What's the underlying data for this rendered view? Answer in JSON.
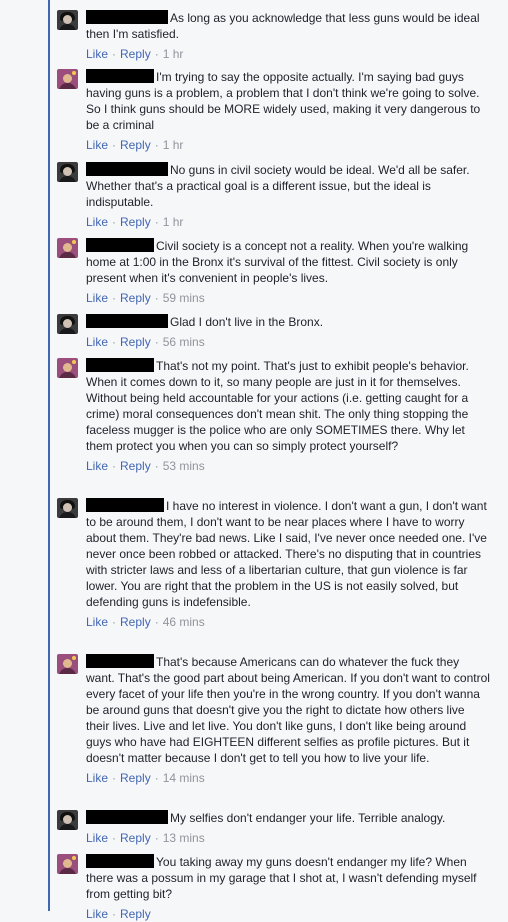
{
  "thread": {
    "separator": "·",
    "comments": [
      {
        "author_type": "a",
        "text": "As long as you acknowledge that less guns would be ideal then I'm satisfied.",
        "like": "Like",
        "reply": "Reply",
        "time": "1 hr"
      },
      {
        "author_type": "b",
        "text": "I'm trying to say the opposite actually. I'm saying bad guys having guns is a problem, a problem that I don't think we're going to solve. So I think guns should be MORE widely used, making it very dangerous to be a criminal",
        "like": "Like",
        "reply": "Reply",
        "time": "1 hr"
      },
      {
        "author_type": "a",
        "text": "No guns in civil society would be ideal. We'd all be safer. Whether that's a practical goal is a different issue, but the ideal is indisputable.",
        "like": "Like",
        "reply": "Reply",
        "time": "1 hr"
      },
      {
        "author_type": "b",
        "text": "Civil society is a concept not a reality. When you're walking home at 1:00 in the Bronx it's survival of the fittest. Civil society is only present when it's convenient in people's lives.",
        "like": "Like",
        "reply": "Reply",
        "time": "59 mins"
      },
      {
        "author_type": "a",
        "text": "Glad I don't live in the Bronx.",
        "like": "Like",
        "reply": "Reply",
        "time": "56 mins"
      },
      {
        "author_type": "b",
        "text": "That's not my point. That's just to exhibit people's behavior. When it comes down to it, so many people are just in it for themselves. Without being held accountable for your actions (i.e. getting caught for a crime) moral consequences don't mean shit. The only thing stopping the faceless mugger is the police who are only SOMETIMES there. Why let them protect you when you can so simply protect yourself?",
        "like": "Like",
        "reply": "Reply",
        "time": "53 mins"
      },
      {
        "author_type": "a",
        "text": "I have no interest in violence. I don't want a gun, I don't want to be around them, I don't want to be near places where I have to worry about them. They're bad news. Like I said, I've never once needed one. I've never once been robbed or attacked. There's no disputing that in countries with stricter laws and less of a libertarian culture, that gun violence is far lower. You are right that the problem in the US is not easily solved, but defending guns is indefensible.",
        "like": "Like",
        "reply": "Reply",
        "time": "46 mins"
      },
      {
        "author_type": "b",
        "text": "That's because Americans can do whatever the fuck they want. That's the good part about being American. If you don't want to control every facet of your life then you're in the wrong country. If you don't wanna be around guns that doesn't give you the right to dictate how others live their lives. Live and let live. You don't like guns, I don't like being around guys who have had EIGHTEEN different selfies as profile pictures. But it doesn't matter because I don't get to tell you how to live your life.",
        "like": "Like",
        "reply": "Reply",
        "time": "14 mins"
      },
      {
        "author_type": "a",
        "text": "My selfies don't endanger your life. Terrible analogy.",
        "like": "Like",
        "reply": "Reply",
        "time": "13 mins"
      },
      {
        "author_type": "b",
        "text": "You taking away my guns doesn't endanger my life? When there was a possum in my garage that I shot at, I wasn't defending myself from getting bit?",
        "like": "Like",
        "reply": "Reply",
        "time": ""
      }
    ]
  }
}
